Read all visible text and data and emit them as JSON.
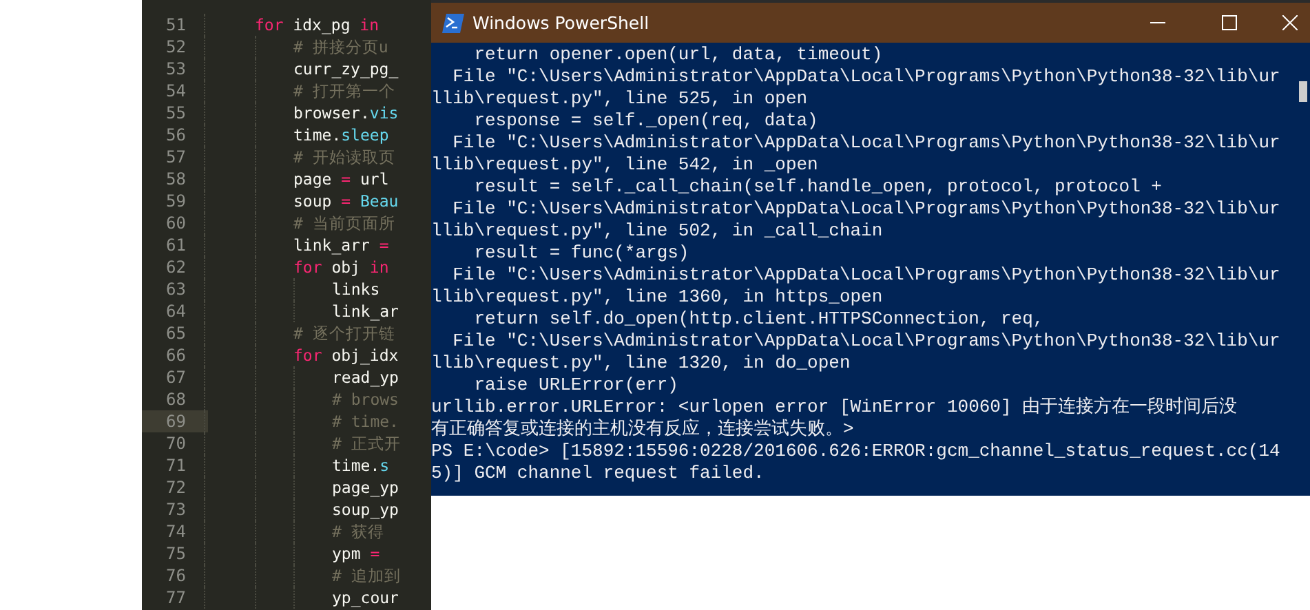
{
  "editor": {
    "lines": [
      {
        "number": "51",
        "highlighted": false,
        "segments": [
          {
            "kind": "keyword",
            "text": "for"
          },
          {
            "kind": "plain",
            "text": " idx_pg "
          },
          {
            "kind": "keyword",
            "text": "in"
          }
        ],
        "children": [
          {
            "number": "52",
            "highlighted": false,
            "segments": [
              {
                "kind": "comment",
                "text": "# 拼接分页u"
              }
            ]
          },
          {
            "number": "53",
            "highlighted": false,
            "segments": [
              {
                "kind": "plain",
                "text": "curr_zy_pg_"
              }
            ]
          },
          {
            "number": "54",
            "highlighted": false,
            "segments": [
              {
                "kind": "comment",
                "text": "# 打开第一个"
              }
            ]
          },
          {
            "number": "55",
            "highlighted": false,
            "segments": [
              {
                "kind": "plain",
                "text": "browser."
              },
              {
                "kind": "call",
                "text": "vis"
              }
            ]
          },
          {
            "number": "56",
            "highlighted": false,
            "segments": [
              {
                "kind": "plain",
                "text": "time."
              },
              {
                "kind": "call",
                "text": "sleep"
              }
            ]
          },
          {
            "number": "57",
            "highlighted": false,
            "segments": [
              {
                "kind": "comment",
                "text": "# 开始读取页"
              }
            ]
          },
          {
            "number": "58",
            "highlighted": false,
            "segments": [
              {
                "kind": "plain",
                "text": "page "
              },
              {
                "kind": "keyword",
                "text": "="
              },
              {
                "kind": "plain",
                "text": " url"
              }
            ]
          },
          {
            "number": "59",
            "highlighted": false,
            "segments": [
              {
                "kind": "plain",
                "text": "soup "
              },
              {
                "kind": "keyword",
                "text": "="
              },
              {
                "kind": "call",
                "text": " Beau"
              }
            ]
          },
          {
            "number": "60",
            "highlighted": false,
            "segments": [
              {
                "kind": "comment",
                "text": "# 当前页面所"
              }
            ]
          },
          {
            "number": "61",
            "highlighted": false,
            "segments": [
              {
                "kind": "plain",
                "text": "link_arr "
              },
              {
                "kind": "keyword",
                "text": "="
              }
            ]
          },
          {
            "number": "62",
            "highlighted": false,
            "segments": [
              {
                "kind": "keyword",
                "text": "for"
              },
              {
                "kind": "plain",
                "text": " obj "
              },
              {
                "kind": "keyword",
                "text": "in"
              }
            ],
            "children": [
              {
                "number": "63",
                "highlighted": false,
                "segments": [
                  {
                    "kind": "plain",
                    "text": "links"
                  }
                ]
              },
              {
                "number": "64",
                "highlighted": false,
                "segments": [
                  {
                    "kind": "plain",
                    "text": "link_ar"
                  }
                ]
              }
            ]
          },
          {
            "number": "65",
            "highlighted": false,
            "segments": [
              {
                "kind": "comment",
                "text": "# 逐个打开链"
              }
            ]
          },
          {
            "number": "66",
            "highlighted": false,
            "segments": [
              {
                "kind": "keyword",
                "text": "for"
              },
              {
                "kind": "plain",
                "text": " obj_idx"
              }
            ],
            "children": [
              {
                "number": "67",
                "highlighted": false,
                "segments": [
                  {
                    "kind": "plain",
                    "text": "read_yp"
                  }
                ]
              },
              {
                "number": "68",
                "highlighted": false,
                "segments": [
                  {
                    "kind": "comment",
                    "text": "# brows"
                  }
                ]
              },
              {
                "number": "69",
                "highlighted": true,
                "segments": [
                  {
                    "kind": "comment",
                    "text": "# time."
                  }
                ]
              },
              {
                "number": "70",
                "highlighted": false,
                "segments": [
                  {
                    "kind": "comment",
                    "text": "# 正式开"
                  }
                ]
              },
              {
                "number": "71",
                "highlighted": false,
                "segments": [
                  {
                    "kind": "plain",
                    "text": "time."
                  },
                  {
                    "kind": "call",
                    "text": "s"
                  }
                ]
              },
              {
                "number": "72",
                "highlighted": false,
                "segments": [
                  {
                    "kind": "plain",
                    "text": "page_yp"
                  }
                ]
              },
              {
                "number": "73",
                "highlighted": false,
                "segments": [
                  {
                    "kind": "plain",
                    "text": "soup_yp"
                  }
                ]
              },
              {
                "number": "74",
                "highlighted": false,
                "segments": [
                  {
                    "kind": "comment",
                    "text": "# 获得"
                  }
                ]
              },
              {
                "number": "75",
                "highlighted": false,
                "segments": [
                  {
                    "kind": "plain",
                    "text": "ypm "
                  },
                  {
                    "kind": "keyword",
                    "text": "="
                  }
                ]
              },
              {
                "number": "76",
                "highlighted": false,
                "segments": [
                  {
                    "kind": "comment",
                    "text": "# 追加到"
                  }
                ]
              },
              {
                "number": "77",
                "highlighted": false,
                "segments": [
                  {
                    "kind": "plain",
                    "text": "yp_cour"
                  }
                ]
              }
            ]
          }
        ]
      }
    ]
  },
  "window": {
    "title": "Windows PowerShell",
    "lines": [
      "    return opener.open(url, data, timeout)",
      "  File \"C:\\Users\\Administrator\\AppData\\Local\\Programs\\Python\\Python38-32\\lib\\ur",
      "llib\\request.py\", line 525, in open",
      "    response = self._open(req, data)",
      "  File \"C:\\Users\\Administrator\\AppData\\Local\\Programs\\Python\\Python38-32\\lib\\ur",
      "llib\\request.py\", line 542, in _open",
      "    result = self._call_chain(self.handle_open, protocol, protocol +",
      "  File \"C:\\Users\\Administrator\\AppData\\Local\\Programs\\Python\\Python38-32\\lib\\ur",
      "llib\\request.py\", line 502, in _call_chain",
      "    result = func(*args)",
      "  File \"C:\\Users\\Administrator\\AppData\\Local\\Programs\\Python\\Python38-32\\lib\\ur",
      "llib\\request.py\", line 1360, in https_open",
      "    return self.do_open(http.client.HTTPSConnection, req,",
      "  File \"C:\\Users\\Administrator\\AppData\\Local\\Programs\\Python\\Python38-32\\lib\\ur",
      "llib\\request.py\", line 1320, in do_open",
      "    raise URLError(err)",
      "urllib.error.URLError: <urlopen error [WinError 10060] 由于连接方在一段时间后没",
      "有正确答复或连接的主机没有反应，连接尝试失败。>",
      "PS E:\\code> [15892:15596:0228/201606.626:ERROR:gcm_channel_status_request.cc(14",
      "5)] GCM channel request failed."
    ]
  }
}
